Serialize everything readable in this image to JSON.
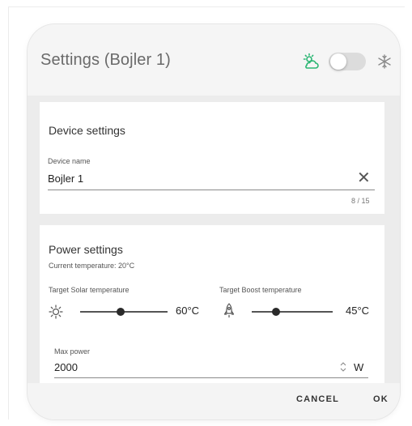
{
  "dialog": {
    "title": "Settings (Bojler 1)",
    "header_icons": [
      "sun-cloud-icon",
      "toggle-switch",
      "snowflake-icon"
    ],
    "toggle_on": false,
    "accent_color": "#2bb673"
  },
  "device_settings": {
    "title": "Device settings",
    "name_label": "Device name",
    "name_value": "Bojler 1",
    "counter": "8 / 15"
  },
  "power_settings": {
    "title": "Power settings",
    "current_temperature": "Current temperature: 20°C",
    "solar_label": "Target Solar temperature",
    "solar_value": "60°C",
    "solar_level": 0.6,
    "boost_label": "Target Boost temperature",
    "boost_value": "45°C",
    "boost_level": 0.4,
    "max_power_label": "Max power",
    "max_power_value": "2000",
    "max_power_unit": "W"
  },
  "buttons": {
    "cancel": "CANCEL",
    "ok": "OK"
  }
}
